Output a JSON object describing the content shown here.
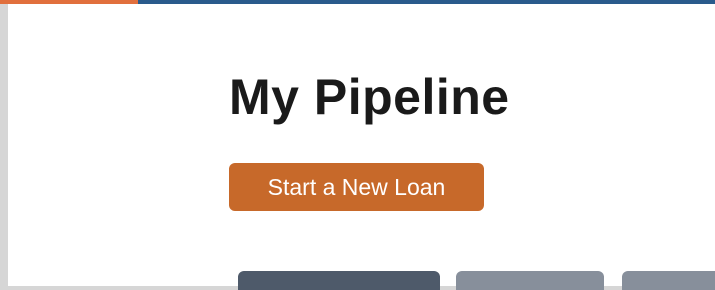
{
  "header": {
    "accent_color": "#e16f3d",
    "bar_color": "#2a5b8c"
  },
  "page": {
    "title": "My Pipeline"
  },
  "actions": {
    "start_new_loan_label": "Start a New Loan",
    "button_color": "#c7692a"
  },
  "tabs": {
    "active_color": "#4e5a6a",
    "inactive_color": "#878f9b"
  }
}
